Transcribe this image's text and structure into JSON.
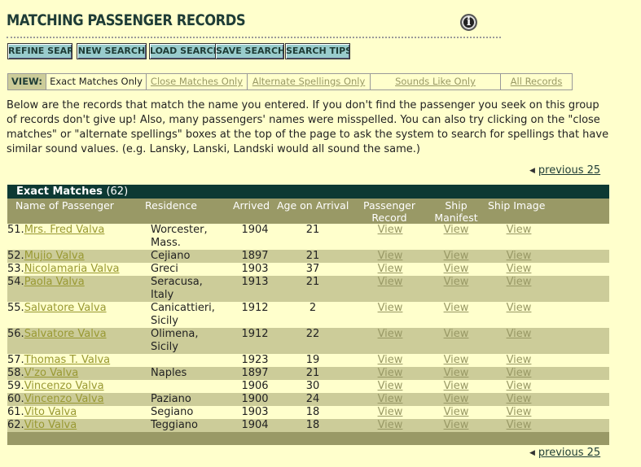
{
  "page": {
    "title": "MATCHING PASSENGER RECORDS",
    "info_icon": "info-icon"
  },
  "buttons": [
    {
      "label": "REFINE SEARCH"
    },
    {
      "label": "NEW SEARCH"
    },
    {
      "label": "LOAD SEARCH"
    },
    {
      "label": "SAVE SEARCH"
    },
    {
      "label": "SEARCH TIPS"
    }
  ],
  "view": {
    "label": "VIEW:",
    "options": [
      {
        "label": "Exact Matches Only",
        "active": true
      },
      {
        "label": "Close Matches Only",
        "active": false
      },
      {
        "label": "Alternate Spellings Only",
        "active": false
      },
      {
        "label": "Sounds Like Only",
        "active": false
      },
      {
        "label": "All Records",
        "active": false
      }
    ]
  },
  "intro": "Below are the records that match the name you entered. If you don't find the passenger you seek on this group of records don't give up! Also, many passengers' names were misspelled. You can also try clicking on the \"close matches\" or \"alternate spellings\" boxes at the top of the page to ask the system to search for spellings that have similar sound values. (e.g. Lansky, Lanski, Landski would all sound the same.)",
  "pagination": {
    "previous": "previous 25"
  },
  "results": {
    "title": "Exact Matches",
    "count": "(62)",
    "columns": [
      "Name of Passenger",
      "Residence",
      "Arrived",
      "Age on Arrival",
      "Passenger Record",
      "Ship Manifest",
      "Ship Image"
    ],
    "view_label": "View",
    "rows": [
      {
        "num": "51.",
        "name": "Mrs. Fred Valva",
        "residence": "Worcester, Mass.",
        "arrived": "1904",
        "age": "21",
        "tall": true
      },
      {
        "num": "52.",
        "name": "Mujio Valva",
        "residence": "Cejiano",
        "arrived": "1897",
        "age": "21"
      },
      {
        "num": "53.",
        "name": "Nicolamaria Valva",
        "residence": "Greci",
        "arrived": "1903",
        "age": "37"
      },
      {
        "num": "54.",
        "name": "Paola Valva",
        "residence": "Seracusa, Italy",
        "arrived": "1913",
        "age": "21",
        "tall": true
      },
      {
        "num": "55.",
        "name": "Salvatore Valva",
        "residence": "Canicattieri, Sicily",
        "arrived": "1912",
        "age": "2",
        "tall": true
      },
      {
        "num": "56.",
        "name": "Salvatore Valva",
        "residence": "Olimena, Sicily",
        "arrived": "1912",
        "age": "22",
        "tall": true
      },
      {
        "num": "57.",
        "name": "Thomas T. Valva",
        "residence": "",
        "arrived": "1923",
        "age": "19"
      },
      {
        "num": "58.",
        "name": "V'zo Valva",
        "residence": "Naples",
        "arrived": "1897",
        "age": "21"
      },
      {
        "num": "59.",
        "name": "Vincenzo Valva",
        "residence": "",
        "arrived": "1906",
        "age": "30"
      },
      {
        "num": "60.",
        "name": "Vincenzo Valva",
        "residence": "Paziano",
        "arrived": "1900",
        "age": "24"
      },
      {
        "num": "61.",
        "name": "Vito Valva",
        "residence": "Segiano",
        "arrived": "1903",
        "age": "18"
      },
      {
        "num": "62.",
        "name": "Vito Valva",
        "residence": "Teggiano",
        "arrived": "1904",
        "age": "18"
      }
    ]
  }
}
